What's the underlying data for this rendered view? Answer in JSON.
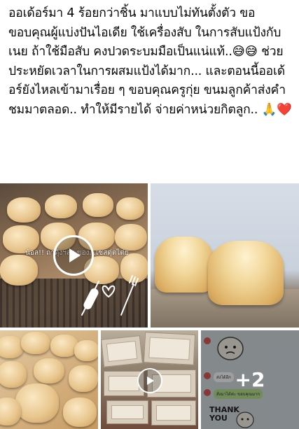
{
  "post": {
    "text": "ออเด้อร์มา 4 ร้อยกว่าชิ้น มาแบบไม่ทันตั้งตัว ขอขอบคุณผู้แบ่งปันไอเดีย ใช้เครื่องสับ ในการสับแป้งกับเนย ถ้าใช้มือสับ คงปวดระบมมือเป็นแน่แท้..😅😅 ช่วยประหยัดเวลาในการผสมแป้งได้มาก... และตอนนี้ออเด้อร์ยังไหลเข้ามาเรื่อย ๆ ขอบคุณครูกุ่ย ขนมลูกค้าส่งคำชมมาตลอด.. ทำให้มีรายได้ จ่ายค่าหน่วยกิตลูก.. 🙏❤️"
  },
  "media": {
    "video1_caption": "น้อล!! ถาดุ้งฯลฯ ของ...เซสดุ่ตไต่ย",
    "more_count": "+2",
    "chat": {
      "bubble1": "ส่งได้อีก",
      "bubble2": "สั่งมาได้ค่ะ ขอบคุณมาก",
      "sticker_text": "THANK\nYOU"
    }
  },
  "icons": {
    "play": "play-icon",
    "rolling_pin": "rolling-pin-icon",
    "fork": "fork-icon",
    "heart": "heart-outline-icon"
  }
}
